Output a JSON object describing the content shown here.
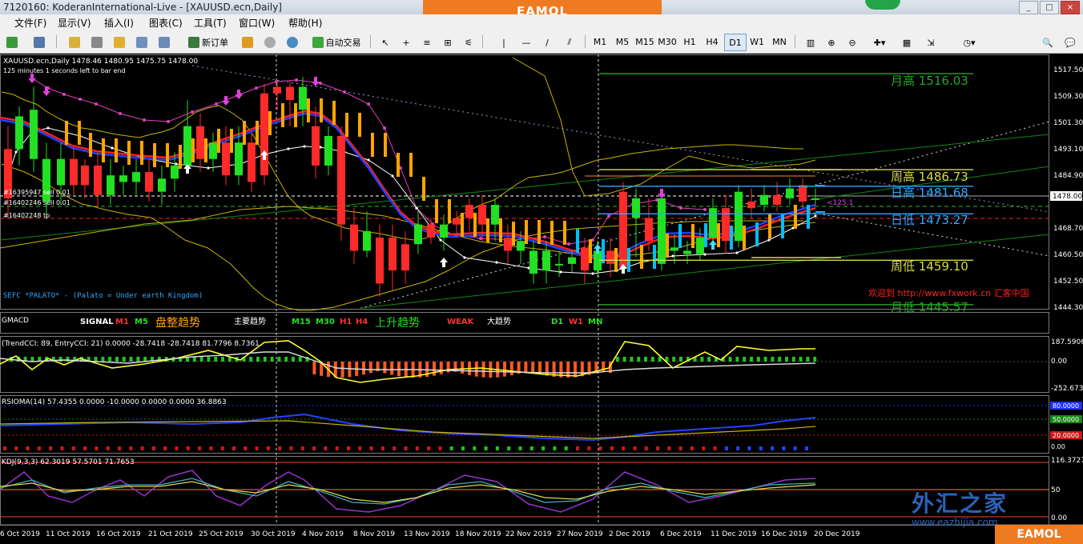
{
  "window": {
    "title": "7120160: KoderanInternational-Live - [XAUUSD.ecn,Daily]"
  },
  "menu": {
    "items": [
      "文件(F)",
      "显示(V)",
      "插入(I)",
      "图表(C)",
      "工具(T)",
      "窗口(W)",
      "帮助(H)"
    ]
  },
  "toolbar": {
    "new_order_label": "新订单",
    "autotrade_label": "自动交易",
    "timeframes": [
      "M1",
      "M5",
      "M15",
      "M30",
      "H1",
      "H4",
      "D1",
      "W1",
      "MN"
    ],
    "active_timeframe": "D1"
  },
  "brand": {
    "banner": "EAMOL",
    "watermark_cn": "外汇之家",
    "watermark_url": "www.eazhijia.com",
    "stamp": "印",
    "accent": "#ee7a22"
  },
  "main_chart": {
    "header": "XAUUSD.ecn,Daily  1478.46 1480.95 1475.75 1478.00",
    "timer": "125 minutes 1 seconds left to bar end",
    "orders": [
      "#16395947 sell 0.01",
      "#16402246 sell 0.01",
      "#16402248 tp"
    ],
    "current_price": "1478.00",
    "price_axis": [
      "1517.50",
      "1509.30",
      "1501.30",
      "1493.10",
      "1484.90",
      "1476.90",
      "1468.70",
      "1460.50",
      "1452.50",
      "1444.30"
    ],
    "levels": [
      {
        "label": "月高 1516.03",
        "price": 1516.03,
        "color": "#22a822"
      },
      {
        "label": "周高 1486.73",
        "price": 1486.73,
        "color": "#d9d94a"
      },
      {
        "label": "日高 1481.68",
        "price": 1481.68,
        "color": "#2fa8ff"
      },
      {
        "label": "日低 1473.27",
        "price": 1473.27,
        "color": "#2fa8ff"
      },
      {
        "label": "周低 1459.10",
        "price": 1459.1,
        "color": "#d9d94a"
      },
      {
        "label": "月低 1445.57",
        "price": 1445.57,
        "color": "#22a822"
      }
    ],
    "pip_label": "<125.1",
    "footer_text": "SEFC *PALATO* - (Palato = Under earth Kingdom)",
    "promo": "欢迎到 http://www.fxwork.cn 汇客中国"
  },
  "gmacd": {
    "name": "GMACD",
    "signal_label": "SIGNAL",
    "sig1": "M1",
    "sig2": "M5",
    "range_text": "盘整趋势",
    "main_trend": "主要趋势",
    "sig3": "M15",
    "sig4": "M30",
    "sig5": "H1",
    "sig6": "H4",
    "up_text": "上升趋势",
    "weak": "WEAK",
    "big_trend": "大趋势",
    "sig7": "D1",
    "sig8": "W1",
    "sig9": "MN"
  },
  "cci": {
    "header": "(TrendCCI: 89, EntryCCI: 21)  0.0000 -28.7418 -28.7418 81.7796 8.7361",
    "axis": [
      "187.5906",
      "0.00",
      "-252.6731"
    ]
  },
  "rsioma": {
    "header": "RSIOMA(14) 57.4355 0.0000 -10.0000 0.0000 0.0000 36.8863",
    "axis": [
      "80.0000",
      "50.0000",
      "20.0000",
      "0.00"
    ]
  },
  "kdj": {
    "header": "KDJ(9,3,3) 62.3019 57.5701 71.7653",
    "axis": [
      "116.3727",
      "50",
      "0.00"
    ]
  },
  "dates": [
    "6 Oct 2019",
    "11 Oct 2019",
    "16 Oct 2019",
    "21 Oct 2019",
    "25 Oct 2019",
    "30 Oct 2019",
    "4 Nov 2019",
    "8 Nov 2019",
    "13 Nov 2019",
    "18 Nov 2019",
    "22 Nov 2019",
    "27 Nov 2019",
    "2 Dec 2019",
    "6 Dec 2019",
    "11 Dec 2019",
    "16 Dec 2019",
    "20 Dec 2019"
  ],
  "colors": {
    "bull": "#22e022",
    "bear": "#ff2a2a",
    "up_bar": "#ffa500",
    "down_bar": "#00bfff",
    "ma_red": "#ff2020",
    "ma_blue": "#2040ff",
    "env": "#c8b400"
  }
}
